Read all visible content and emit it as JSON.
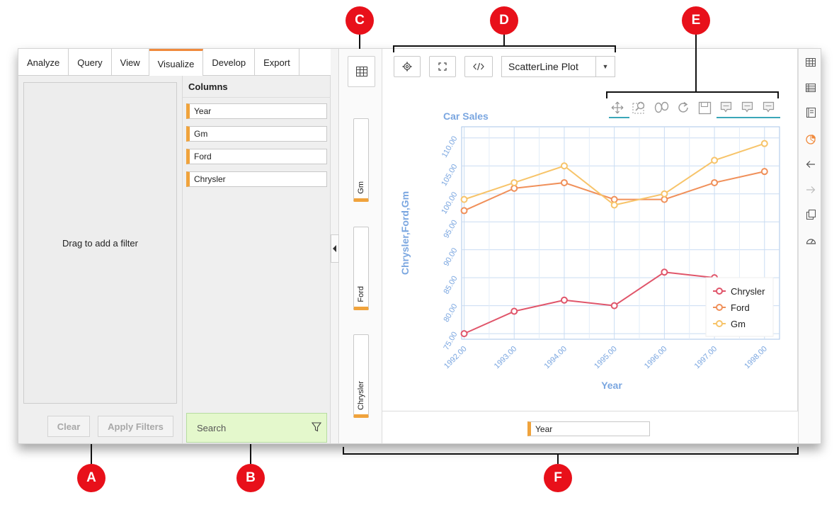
{
  "tabs": [
    "Analyze",
    "Query",
    "View",
    "Visualize",
    "Develop",
    "Export"
  ],
  "active_tab": "Visualize",
  "filter_panel": {
    "drop_text": "Drag to add a filter",
    "clear_label": "Clear",
    "apply_label": "Apply Filters"
  },
  "columns_panel": {
    "title": "Columns",
    "items": [
      "Year",
      "Gm",
      "Ford",
      "Chrysler"
    ],
    "search_placeholder": "Search"
  },
  "field_well": {
    "pills": [
      "Gm",
      "Ford",
      "Chrysler"
    ]
  },
  "toolbar": {
    "plot_type": "ScatterLine Plot"
  },
  "x_axis_pill": "Year",
  "callouts": [
    "A",
    "B",
    "C",
    "D",
    "E",
    "F"
  ],
  "colors": {
    "accent": "#f08a3c",
    "pill_accent": "#f0a33c",
    "callout": "#e8101a",
    "axis_text": "#7aa6e0",
    "chrysler": "#e0556a",
    "ford": "#f0905a",
    "gm": "#f7c46a"
  },
  "chart_data": {
    "type": "line",
    "title": "Car Sales",
    "xlabel": "Year",
    "ylabel": "Chrysler,Ford,Gm",
    "x": [
      1992,
      1993,
      1994,
      1995,
      1996,
      1997,
      1998
    ],
    "x_tick_labels": [
      "1992.00",
      "1993.00",
      "1994.00",
      "1995.00",
      "1996.00",
      "1997.00",
      "1998.00"
    ],
    "y_tick_labels": [
      "75.00",
      "80.00",
      "85.00",
      "90.00",
      "95.00",
      "100.00",
      "105.00",
      "110.00"
    ],
    "ylim": [
      74,
      112
    ],
    "grid": true,
    "legend_position": "bottom-right",
    "series": [
      {
        "name": "Chrysler",
        "values": [
          75,
          79,
          81,
          80,
          86,
          85,
          84
        ]
      },
      {
        "name": "Ford",
        "values": [
          97,
          101,
          102,
          99,
          99,
          102,
          104
        ]
      },
      {
        "name": "Gm",
        "values": [
          99,
          102,
          105,
          98,
          100,
          106,
          109
        ]
      }
    ]
  }
}
